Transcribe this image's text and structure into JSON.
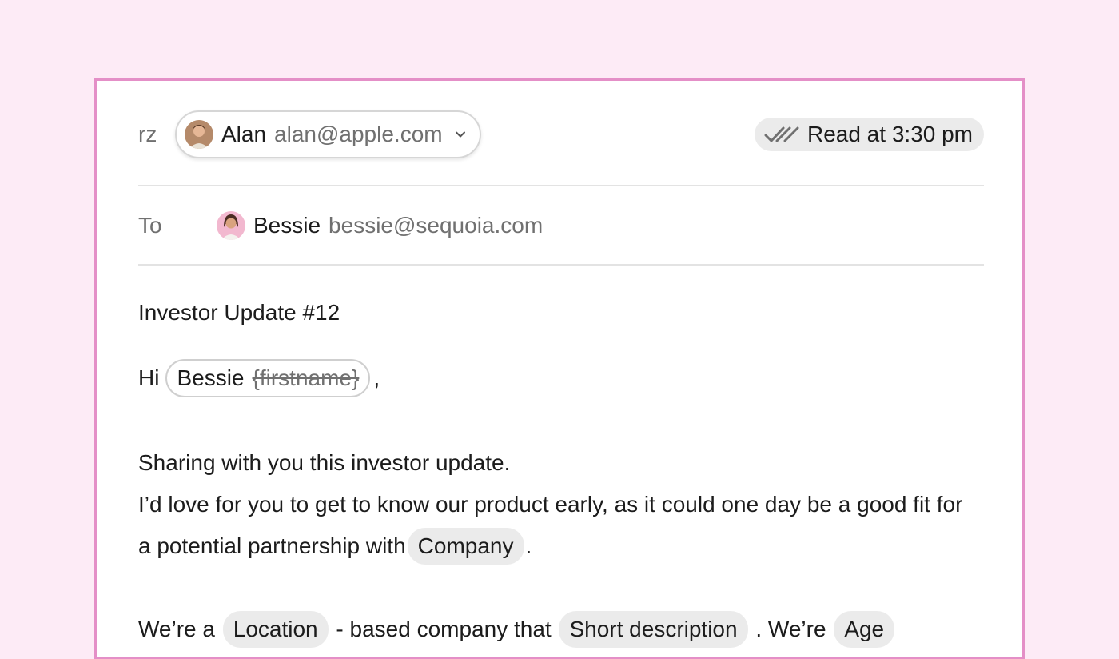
{
  "from": {
    "label": "rz",
    "sender_name": "Alan",
    "sender_email": "alan@apple.com"
  },
  "status": {
    "read_text": "Read at 3:30 pm"
  },
  "to": {
    "label": "To",
    "recipient_name": "Bessie",
    "recipient_email": "bessie@sequoia.com"
  },
  "subject": "Investor Update #12",
  "body": {
    "greeting_prefix": "Hi",
    "greeting_name": "Bessie",
    "greeting_variable": "{firstname}",
    "greeting_suffix": ",",
    "line1": "Sharing with you this investor update.",
    "line2_start": "I’d love for you to get to know our product early, as it could one day be a good fit for a potential partnership with",
    "var_company": "Company",
    "line2_end": ".",
    "line3_a": "We’re a",
    "var_location": "Location",
    "line3_b": "- based company that",
    "var_short_description": "Short description",
    "line3_c": ". We’re",
    "var_age": "Age"
  },
  "colors": {
    "page_bg": "#fdebf6",
    "card_border": "#e48fc7",
    "chip_bg": "#ebebeb"
  },
  "icons": [
    "chevron-down-icon",
    "double-check-icon",
    "avatar-alan",
    "avatar-bessie"
  ]
}
